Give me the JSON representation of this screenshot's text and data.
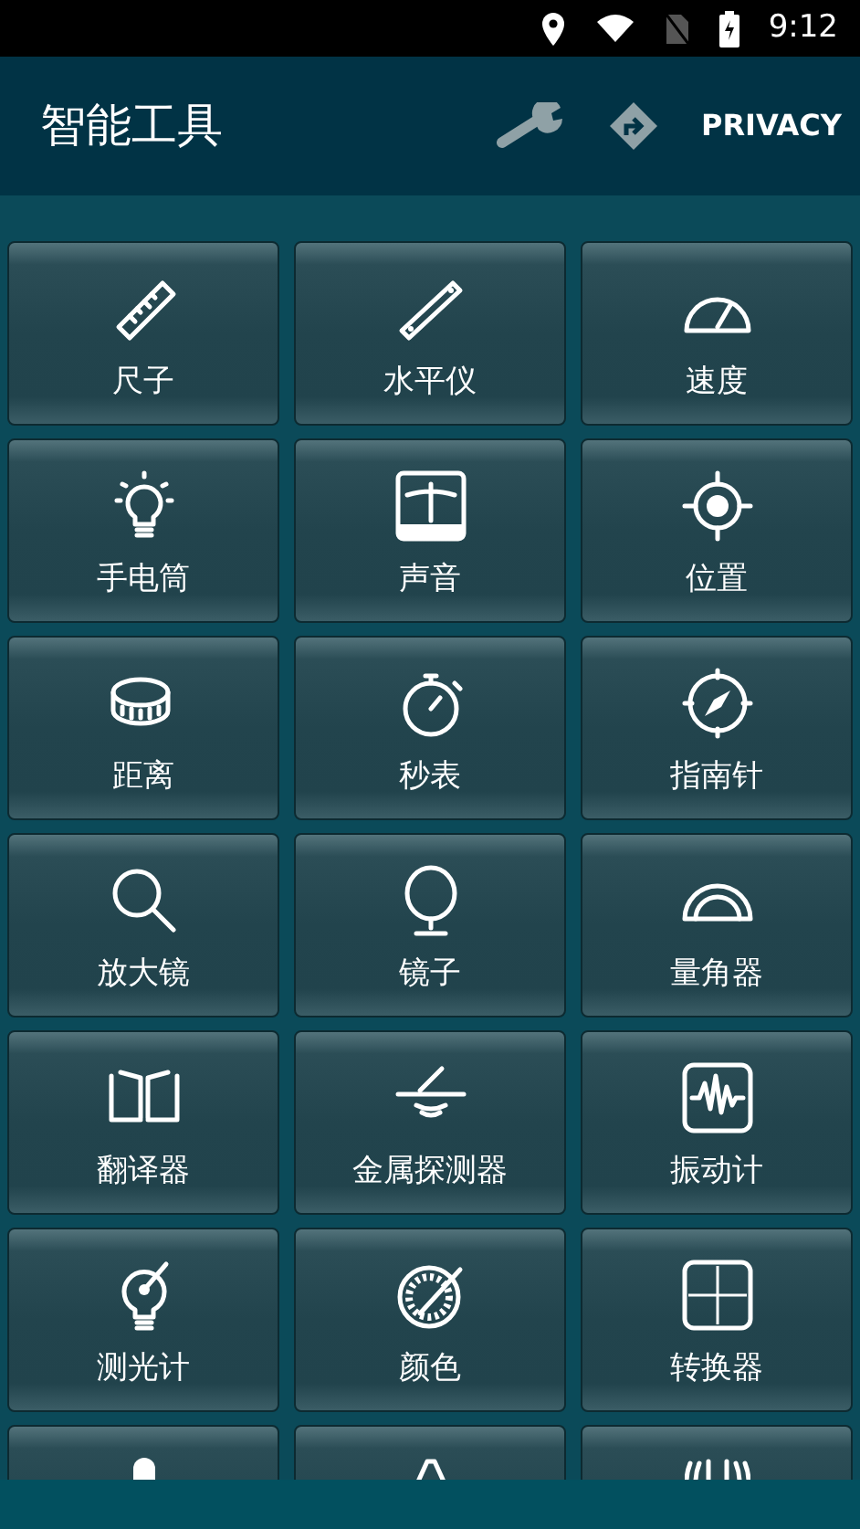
{
  "status_bar": {
    "time": "9:12"
  },
  "app_bar": {
    "title": "智能工具",
    "privacy_link": "PRIVACY"
  },
  "tools": [
    {
      "label": "尺子"
    },
    {
      "label": "水平仪"
    },
    {
      "label": "速度"
    },
    {
      "label": "手电筒"
    },
    {
      "label": "声音"
    },
    {
      "label": "位置"
    },
    {
      "label": "距离"
    },
    {
      "label": "秒表"
    },
    {
      "label": "指南针"
    },
    {
      "label": "放大镜"
    },
    {
      "label": "镜子"
    },
    {
      "label": "量角器"
    },
    {
      "label": "翻译器"
    },
    {
      "label": "金属探测器"
    },
    {
      "label": "振动计"
    },
    {
      "label": "测光计"
    },
    {
      "label": "颜色"
    },
    {
      "label": "转换器"
    }
  ]
}
